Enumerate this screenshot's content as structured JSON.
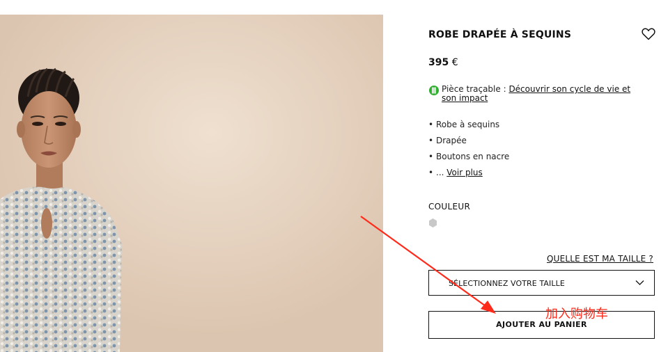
{
  "product": {
    "title": "ROBE DRAPÉE À SEQUINS",
    "price_amount": "395",
    "price_currency": "€",
    "traceability_label": "Pièce traçable : ",
    "traceability_link": "Découvrir son cycle de vie et son impact"
  },
  "features": [
    "Robe à sequins",
    "Drapée",
    "Boutons en nacre"
  ],
  "see_more": {
    "prefix": "... ",
    "link": "Voir plus"
  },
  "color": {
    "label": "COULEUR",
    "swatch_color": "#c8c8c8"
  },
  "size": {
    "guide_link": "QUELLE EST MA TAILLE ?",
    "select_value": "SÉLECTIONNEZ VOTRE TAILLE"
  },
  "cart": {
    "button_label": "AJOUTER AU PANIER"
  },
  "annotation": {
    "text": "加入购物车",
    "color": "#ff2a1a"
  },
  "icons": {
    "wishlist": "heart-icon",
    "traceability": "leaf-icon",
    "dropdown": "chevron-down-icon"
  }
}
